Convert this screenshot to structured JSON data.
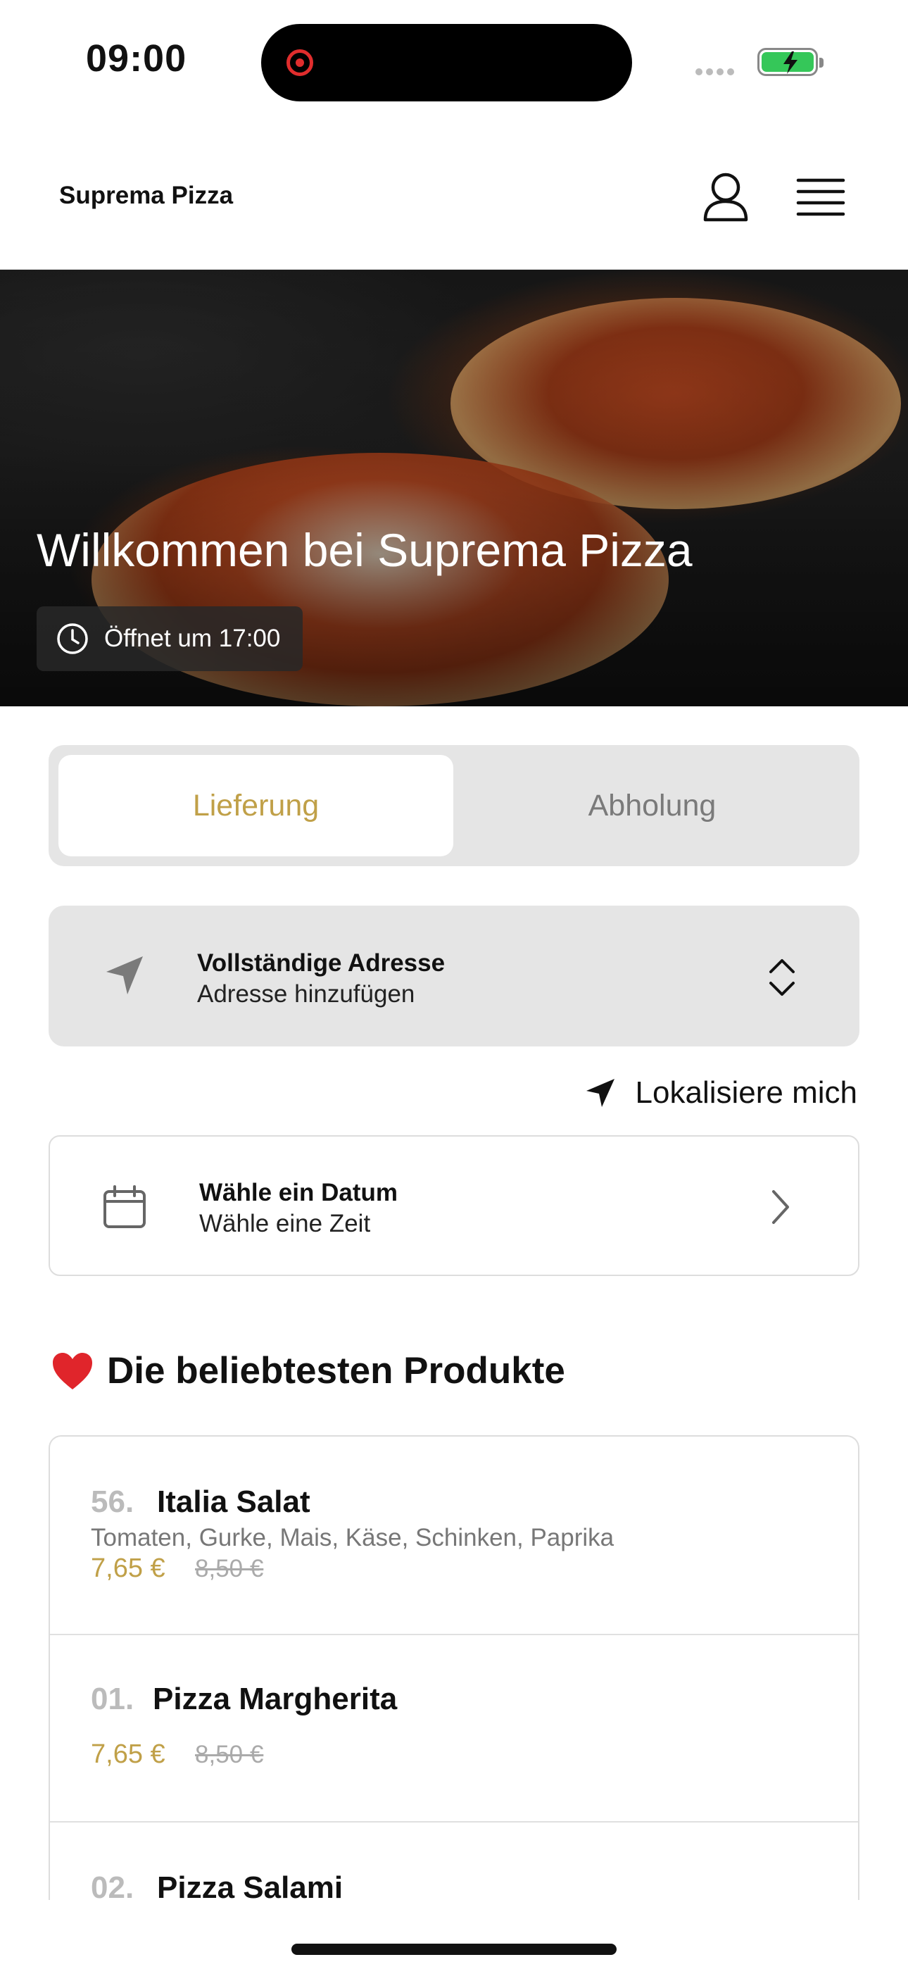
{
  "status": {
    "time": "09:00"
  },
  "header": {
    "title": "Suprema Pizza"
  },
  "hero": {
    "title": "Willkommen bei Suprema Pizza",
    "open_text": "Öffnet um 17:00"
  },
  "mode": {
    "delivery_label": "Lieferung",
    "pickup_label": "Abholung",
    "selected": "Lieferung"
  },
  "address": {
    "title": "Vollständige Adresse",
    "subtitle": "Adresse hinzufügen"
  },
  "locate": {
    "label": "Lokalisiere mich"
  },
  "date": {
    "title": "Wähle ein Datum",
    "subtitle": "Wähle eine Zeit"
  },
  "popular": {
    "heading": "Die beliebtesten Produkte",
    "items": [
      {
        "number": "56.",
        "name": "Italia Salat",
        "description": "Tomaten, Gurke, Mais, Käse, Schinken, Paprika",
        "price": "7,65 €",
        "old_price": "8,50 €"
      },
      {
        "number": "01.",
        "name": "Pizza Margherita",
        "description": "",
        "price": "7,65 €",
        "old_price": "8,50 €"
      },
      {
        "number": "02.",
        "name": "Pizza Salami"
      }
    ]
  },
  "colors": {
    "accent": "#c0a048",
    "segment_bg": "#e5e5e5",
    "muted": "#7a7a7a"
  }
}
